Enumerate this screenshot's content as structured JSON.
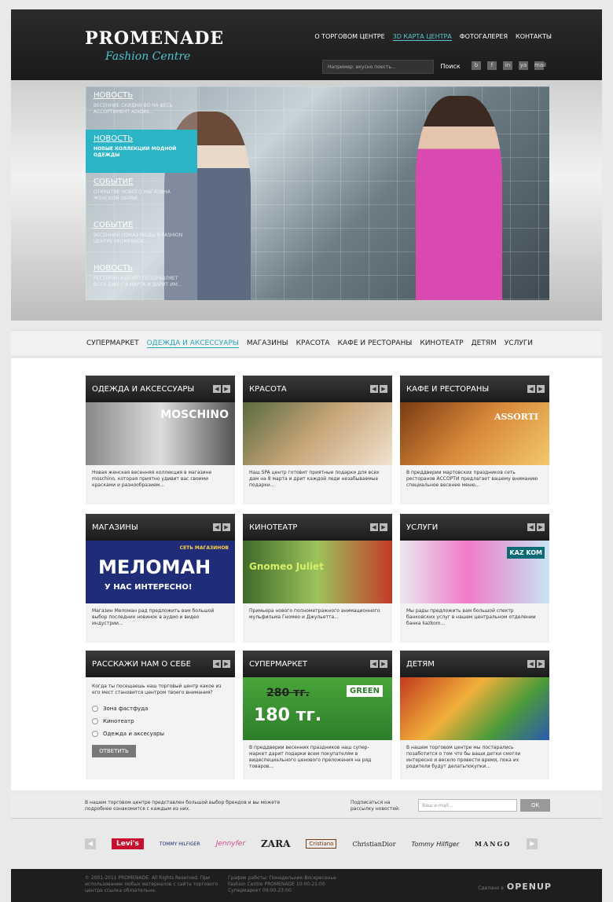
{
  "header": {
    "logo_title": "PROMENADE",
    "logo_sub": "Fashion Centre",
    "nav": [
      "О ТОРГОВОМ ЦЕНТРЕ",
      "3D КАРТА ЦЕНТРА",
      "ФОТОГАЛЕРЕЯ",
      "КОНТАКТЫ"
    ],
    "search_placeholder": "Например: вкусно поесть...",
    "search_button": "Поиск",
    "social_icons": [
      "b",
      "f",
      "in",
      "ya",
      "mail"
    ]
  },
  "hero_news": [
    {
      "title": "НОВОСТЬ",
      "text": "ВЕСЕННИЕ СКИДКИ ВО НА ВЕСЬ АССОРТИМЕНТ ADIDAS..."
    },
    {
      "title": "НОВОСТЬ",
      "text": "НОВЫЕ КОЛЛЕКЦИИ МОДНОЙ ОДЕЖДЫ",
      "active": true
    },
    {
      "title": "СОБЫТИЕ",
      "text": "ОТКРЫТИЕ НОВОГО МАГАЗИНА ЖЕНСКОЙ ОБУВИ..."
    },
    {
      "title": "СОБЫТИЕ",
      "text": "ВЕСЕННИЙ ПОКАЗ МОДЫ В FASHION ЦЕНТРЕ PROMENADE..."
    },
    {
      "title": "НОВОСТЬ",
      "text": "РЕСТОРАН ASSORTI ПОЗДРАВЛЯЕТ ВСЕХ ДАМ С 8 МАРТА И ДАРИТ ИМ..."
    }
  ],
  "catnav": [
    "СУПЕРМАРКЕТ",
    "ОДЕЖДА И АКСЕССУАРЫ",
    "МАГАЗИНЫ",
    "КРАСОТА",
    "КАФЕ И РЕСТОРАНЫ",
    "КИНОТЕАТР",
    "ДЕТЯМ",
    "УСЛУГИ"
  ],
  "cards": {
    "clothes": {
      "title": "ОДЕЖДА И АКСЕССУАРЫ",
      "caption": "MOSCHINO",
      "text": "Новая женская весенняя коллекция в магазине moschino, которая приятно удивит вас своими красками и разнообразием..."
    },
    "beauty": {
      "title": "КРАСОТА",
      "text": "Наш SPA центр готовит приятные подарки для всех дам на 8 марта и дрит каждой леди незабываемые подарки..."
    },
    "cafe": {
      "title": "КАФЕ И РЕСТОРАНЫ",
      "caption": "ASSORTI",
      "text": "В преддверии мартовских праздников сеть ресторанов АССОРТИ предлагает вашему вниманию специальное весенее меню..."
    },
    "shops": {
      "title": "МАГАЗИНЫ",
      "caption_small": "СЕТЬ МАГАЗИНОВ",
      "caption": "МЕЛОМАН",
      "caption_sub": "У НАС ИНТЕРЕСНО!",
      "text": "Магазин Меломан рад предложить вам большой выбор последних новинок в аудио и видео индустрии..."
    },
    "cinema": {
      "title": "КИНОТЕАТР",
      "caption": "Gnomeo Juliet",
      "text": "Примьера нового полнометражного анимационного мульфильма Гномео и Джульетта..."
    },
    "services": {
      "title": "УСЛУГИ",
      "caption": "KAZ KOM",
      "text": "Мы рады предложить вам большой спектр банковских услуг в нашем центральном отделении банка kazkom..."
    },
    "poll": {
      "title": "РАССКАЖИ НАМ О СЕБЕ",
      "question": "Когда ты посещаешь наш торговый центр какое из его мест становится центром твоего внимания?",
      "options": [
        "Зона фастфуда",
        "Кинотеатр",
        "Одежда и аксесуары"
      ],
      "button": "ОТВЕТИТЬ"
    },
    "market": {
      "title": "СУПЕРМАРКЕТ",
      "old_price": "280 тг.",
      "new_price": "180 тг.",
      "brand": "GREEN",
      "text": "В преддверии весенних праздников наш супер-маркет дарит подарки всем покупателям в видеспециального ценового преложения на ряд товаров..."
    },
    "kids": {
      "title": "ДЕТЯМ",
      "text": "В нашем торговом центре мы постарались позаботится о том что бы ваши детки смогли интересно и весело провести время, пока их родители будут делатьпокупки..."
    }
  },
  "subscribe": {
    "text": "В нашем торговом центре представлен большой выбор брендов и вы можете подробнее ознакомится с каждым из них.",
    "label": "Подписаться на рассылку новостей:",
    "placeholder": "Ваш e-mail...",
    "button": "OK"
  },
  "brands": [
    "Levi's",
    "TOMMY HILFIGER",
    "Jennyfer",
    "ZARA",
    "Cristiano",
    "ChristianDior",
    "Tommy Hilfiger",
    "MANGO"
  ],
  "footer": {
    "copyright": "© 2001-2011 PROMENADE. All Rights Reserved. При использовании любых материалов с сайта торгового центра ссылка обязательна.",
    "hours": "График работы: Понедельник-Воскресенье Fashion Centre PROMENADE 10:00-21:00 Супермаркет 09:00-23:00",
    "made_by_label": "Сделано в",
    "made_by": "OPENUP"
  },
  "colors": {
    "accent": "#2bb3c6",
    "dark": "#1b1b1b"
  }
}
